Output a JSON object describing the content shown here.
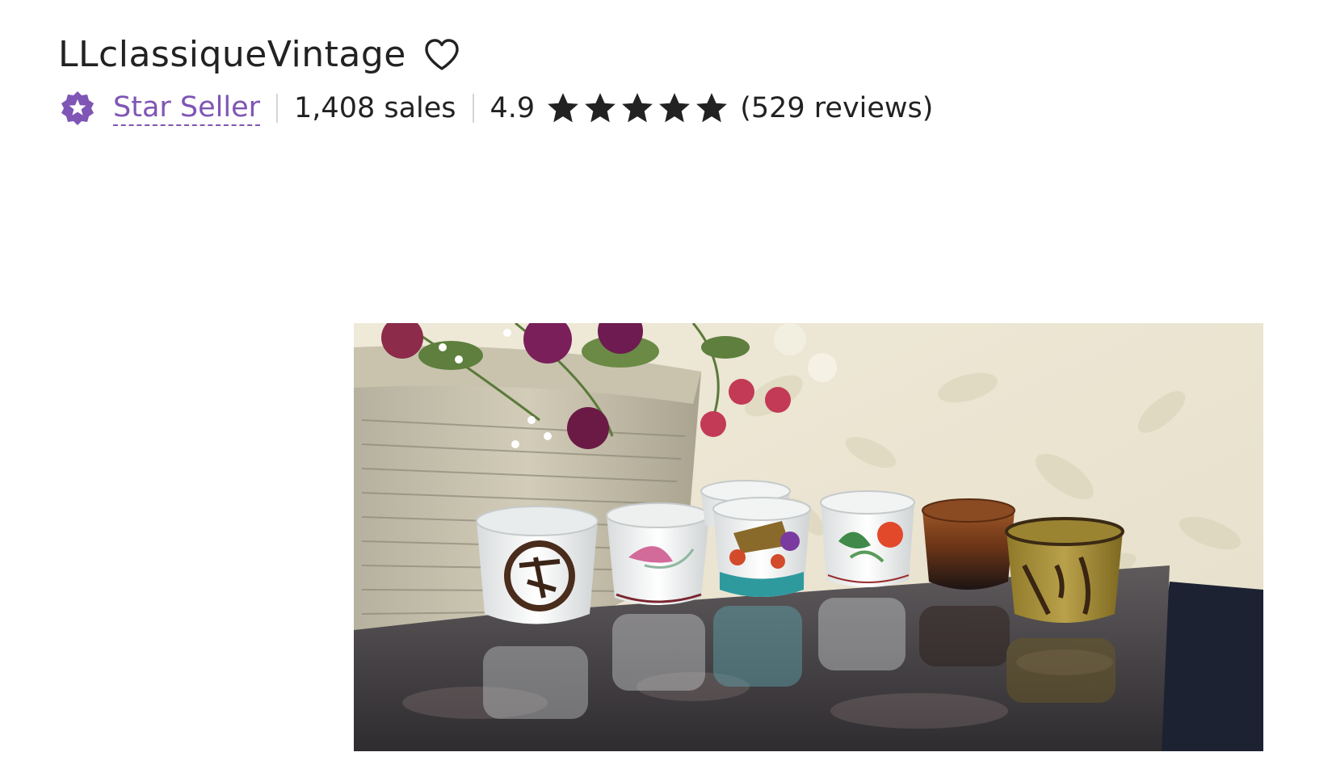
{
  "shop": {
    "name": "LLclassiqueVintage",
    "favorite_icon": "heart-outline-icon"
  },
  "meta": {
    "badge_icon": "star-seller-badge-icon",
    "star_seller_label": "Star Seller",
    "sales": "1,408 sales",
    "rating": "4.9",
    "rating_stars": 5,
    "reviews": "(529 reviews)"
  },
  "banner": {
    "image": "shop-banner-photo"
  },
  "colors": {
    "accent": "#7f55b5",
    "text": "#222222",
    "divider": "#d5d5d5"
  }
}
